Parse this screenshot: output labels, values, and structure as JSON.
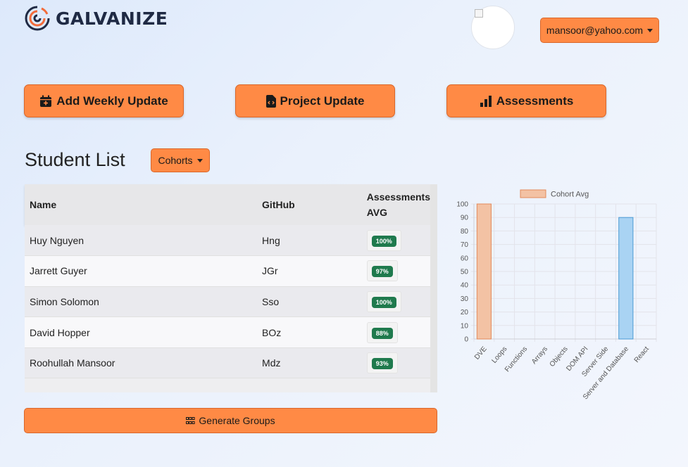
{
  "brand": {
    "name": "GALVANIZE"
  },
  "header": {
    "user_email": "mansoor@yahoo.com"
  },
  "actions": {
    "add_weekly_update": "Add Weekly Update",
    "project_update": "Project Update",
    "assessments": "Assessments"
  },
  "student_list": {
    "title": "Student List",
    "cohorts_label": "Cohorts",
    "columns": {
      "name": "Name",
      "github": "GitHub",
      "assessments_line1": "Assessments",
      "assessments_line2": "AVG"
    },
    "rows": [
      {
        "name": "Huy Nguyen",
        "github": "Hng",
        "avg": "100%"
      },
      {
        "name": "Jarrett Guyer",
        "github": "JGr",
        "avg": "97%"
      },
      {
        "name": "Simon Solomon",
        "github": "Sso",
        "avg": "100%"
      },
      {
        "name": "David Hopper",
        "github": "BOz",
        "avg": "88%"
      },
      {
        "name": "Roohullah Mansoor",
        "github": "Mdz",
        "avg": "93%"
      }
    ]
  },
  "generate_groups_label": "Generate Groups",
  "colors": {
    "accent": "#ff8a45",
    "badge": "#1f7a4d",
    "bar_orange": "#f3c2a4",
    "bar_blue": "#a9d3f3"
  },
  "chart_data": {
    "type": "bar",
    "title": "",
    "xlabel": "",
    "ylabel": "",
    "legend": "top",
    "ylim": [
      0,
      100
    ],
    "yticks": [
      0,
      10,
      20,
      30,
      40,
      50,
      60,
      70,
      80,
      90,
      100
    ],
    "grid": true,
    "categories": [
      "DVE",
      "Loops",
      "Functions",
      "Arrays",
      "Objects",
      "DOM API",
      "Server Side",
      "Server and Database",
      "React"
    ],
    "series": [
      {
        "name": "Cohort Avg",
        "values": [
          100,
          null,
          null,
          null,
          null,
          null,
          null,
          90,
          null
        ]
      }
    ],
    "bar_colors": [
      "orange",
      null,
      null,
      null,
      null,
      null,
      null,
      "blue",
      null
    ]
  }
}
